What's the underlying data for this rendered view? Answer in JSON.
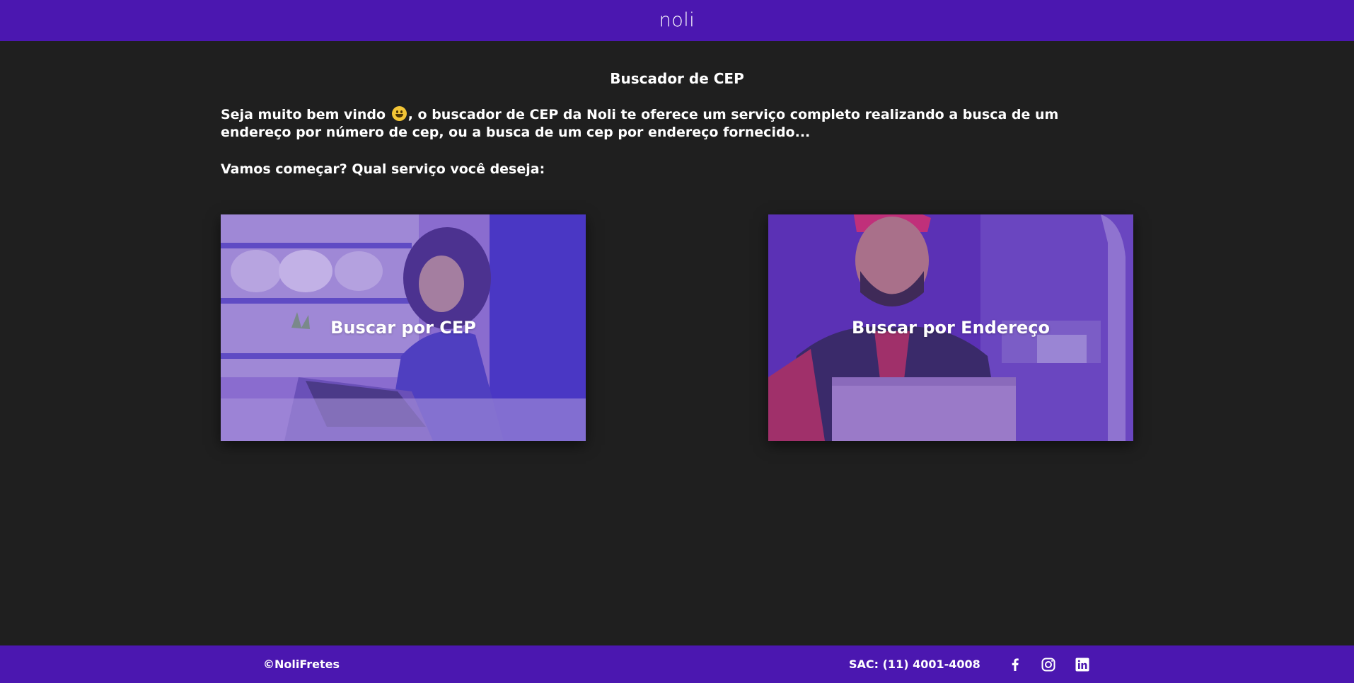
{
  "header": {
    "logo": "noli"
  },
  "main": {
    "title": "Buscador de CEP",
    "intro_before_emoji": "Seja muito bem vindo ",
    "intro_after_emoji": ", o buscador de CEP da Noli te oferece um serviço completo realizando a busca de um endereço por número de cep, ou a busca de um cep por endereço fornecido...",
    "question": "Vamos começar? Qual serviço você deseja:"
  },
  "cards": [
    {
      "label": "Buscar por CEP"
    },
    {
      "label": "Buscar por Endereço"
    }
  ],
  "footer": {
    "copyright": "©NoliFretes",
    "sac": "SAC: (11) 4001-4008",
    "social": [
      "facebook-icon",
      "instagram-icon",
      "linkedin-icon"
    ]
  },
  "colors": {
    "brand": "#4b17b0",
    "background": "#1f1f1f",
    "card_overlay": "#7b4fd6"
  },
  "icons": [
    "grinning-face-emoji"
  ]
}
